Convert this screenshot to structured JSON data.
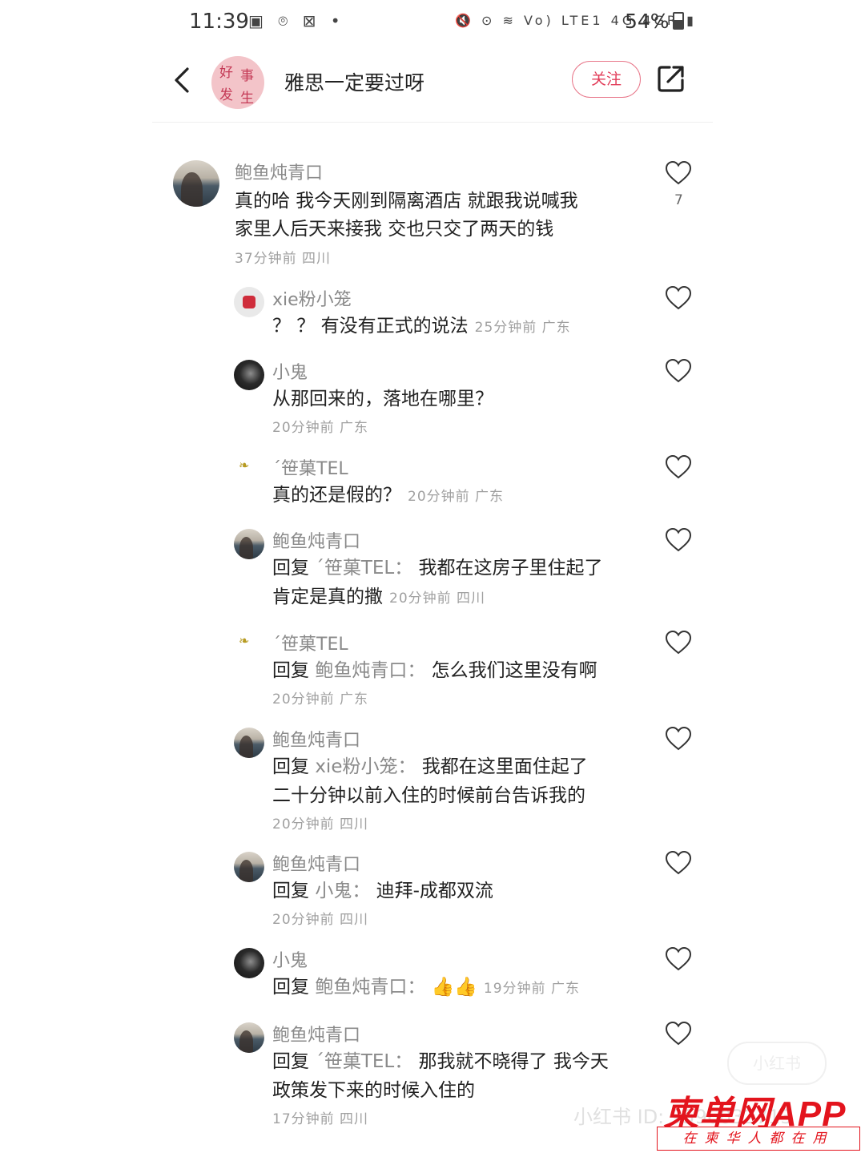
{
  "status_bar": {
    "time": "11:39",
    "left_icons": "▣ ⌾ ⊠ •",
    "right_icons": "🔇 ⊙ ≋ Vo) LTE1 4G 4GR ▮",
    "battery": "54%"
  },
  "header": {
    "avatar_chars": [
      "好",
      "事",
      "发",
      "生"
    ],
    "title": "雅思一定要过呀",
    "follow_label": "关注",
    "back_icon": "back-chevron-icon",
    "share_icon": "share-icon"
  },
  "comments": [
    {
      "name": "鲍鱼炖青口",
      "text": "真的哈 我今天刚到隔离酒店 就跟我说喊我",
      "text2": "家里人后天来接我 交也只交了两天的钱",
      "meta": "37分钟前  四川",
      "likes": "7"
    },
    {
      "name": "xie粉小笼",
      "text": "？ ？ 有没有正式的说法",
      "meta_inline": "25分钟前  广东"
    },
    {
      "name": "小鬼",
      "text": "从那回来的，落地在哪里？",
      "meta": "20分钟前  广东"
    },
    {
      "name": "´笹菓TEL",
      "text": "真的还是假的？",
      "meta_inline": "20分钟前  广东"
    },
    {
      "name": "鲍鱼炖青口",
      "reply_prefix": "回复 ",
      "reply_to": "´笹菓TEL：",
      "text": " 我都在这房子里住起了",
      "text2": "肯定是真的撒",
      "meta_inline2": "20分钟前  四川"
    },
    {
      "name": "´笹菓TEL",
      "reply_prefix": "回复 ",
      "reply_to": "鲍鱼炖青口：",
      "text": " 怎么我们这里没有啊",
      "meta": "20分钟前  广东"
    },
    {
      "name": "鲍鱼炖青口",
      "reply_prefix": "回复 ",
      "reply_to": "xie粉小笼：",
      "text": " 我都在这里面住起了",
      "text2": "二十分钟以前入住的时候前台告诉我的",
      "meta": "20分钟前  四川"
    },
    {
      "name": "鲍鱼炖青口",
      "reply_prefix": "回复 ",
      "reply_to": "小鬼：",
      "text": " 迪拜-成都双流",
      "meta": "20分钟前  四川"
    },
    {
      "name": "小鬼",
      "reply_prefix": "回复 ",
      "reply_to": "鲍鱼炖青口：",
      "text": " 👍👍",
      "meta_inline": "19分钟前  广东"
    },
    {
      "name": "鲍鱼炖青口",
      "reply_prefix": "回复 ",
      "reply_to": "´笹菓TEL：",
      "text": " 那我就不晓得了 我今天",
      "text2": "政策发下来的时候入住的",
      "meta": "17分钟前  四川"
    }
  ],
  "watermark": {
    "xhs_badge": "小红书",
    "xhs_id": "小红书 ID: 9596032713",
    "brand": "柬单网APP",
    "slogan": "在柬华人都在用"
  }
}
